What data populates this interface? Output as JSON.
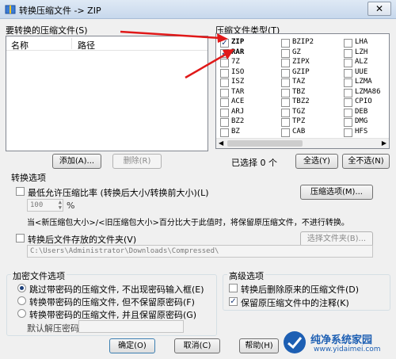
{
  "window": {
    "title": "转换压缩文件 -> ZIP",
    "close_label": "✕"
  },
  "left": {
    "section_label": "要转换的压缩文件(S)",
    "columns": [
      "名称",
      "路径"
    ],
    "add_label": "添加(A)...",
    "delete_label": "删除(R)"
  },
  "types": {
    "section_label": "压缩文件类型(T)",
    "columns": [
      [
        {
          "name": "ZIP",
          "checked": true,
          "bold": true
        },
        {
          "name": "RAR",
          "checked": true,
          "bold": true
        },
        {
          "name": "7Z",
          "checked": false
        },
        {
          "name": "ISO",
          "checked": false
        },
        {
          "name": "ISZ",
          "checked": false
        },
        {
          "name": "TAR",
          "checked": false
        },
        {
          "name": "ACE",
          "checked": false
        },
        {
          "name": "ARJ",
          "checked": false
        },
        {
          "name": "BZ2",
          "checked": false
        },
        {
          "name": "BZ",
          "checked": false
        }
      ],
      [
        {
          "name": "BZIP2",
          "checked": false
        },
        {
          "name": "GZ",
          "checked": false
        },
        {
          "name": "ZIPX",
          "checked": false
        },
        {
          "name": "GZIP",
          "checked": false
        },
        {
          "name": "TAZ",
          "checked": false
        },
        {
          "name": "TBZ",
          "checked": false
        },
        {
          "name": "TBZ2",
          "checked": false
        },
        {
          "name": "TGZ",
          "checked": false
        },
        {
          "name": "TPZ",
          "checked": false
        },
        {
          "name": "CAB",
          "checked": false
        }
      ],
      [
        {
          "name": "LHA",
          "checked": false
        },
        {
          "name": "LZH",
          "checked": false
        },
        {
          "name": "ALZ",
          "checked": false
        },
        {
          "name": "UUE",
          "checked": false
        },
        {
          "name": "LZMA",
          "checked": false
        },
        {
          "name": "LZMA86",
          "checked": false
        },
        {
          "name": "CPIO",
          "checked": false
        },
        {
          "name": "DEB",
          "checked": false
        },
        {
          "name": "DMG",
          "checked": false
        },
        {
          "name": "HFS",
          "checked": false
        }
      ]
    ],
    "selected_text": "已选择 0 个",
    "select_all_label": "全选(Y)",
    "select_none_label": "全不选(N)"
  },
  "convert": {
    "section_label": "转换选项",
    "min_ratio_label": "最低允许压缩比率 (转换后大小/转换前大小)(L)",
    "compress_options_label": "压缩选项(M)...",
    "ratio_value": "100",
    "percent": "%",
    "ratio_note": "当<新压缩包大小>/<旧压缩包大小>百分比大于此值时，将保留原压缩文件，不进行转换。",
    "save_folder_label": "转换后文件存放的文件夹(V)",
    "choose_folder_label": "选择文件夹(B)...",
    "folder_path": "C:\\Users\\Administrator\\Downloads\\Compressed\\"
  },
  "encrypt": {
    "section_label": "加密文件选项",
    "options": [
      "跳过带密码的压缩文件, 不出现密码输入框(E)",
      "转换带密码的压缩文件, 但不保留原密码(F)",
      "转换带密码的压缩文件, 并且保留原密码(G)"
    ],
    "selected": 0,
    "default_pwd_label": "默认解压密码:"
  },
  "advanced": {
    "section_label": "高级选项",
    "delete_original_label": "转换后删除原来的压缩文件(D)",
    "keep_comment_label": "保留原压缩文件中的注释(K)"
  },
  "footer": {
    "ok_label": "确定(O)",
    "cancel_label": "取消(C)",
    "help_label": "帮助(H)"
  },
  "watermark": {
    "site_name": "纯净系统家园",
    "url": "www.yidaimei.com"
  },
  "colors": {
    "arrow": "#e01919",
    "watermark_blue": "#1d5fb3"
  }
}
